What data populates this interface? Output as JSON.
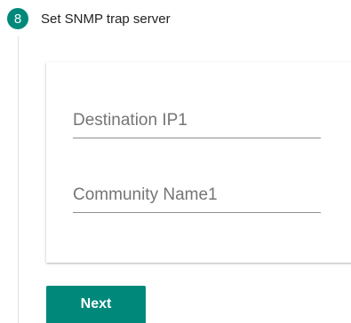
{
  "step": {
    "number": "8",
    "title": "Set SNMP trap server"
  },
  "form": {
    "destination_ip": {
      "placeholder": "Destination IP1",
      "value": ""
    },
    "community_name": {
      "placeholder": "Community Name1",
      "value": ""
    }
  },
  "actions": {
    "next_label": "Next"
  },
  "colors": {
    "accent": "#00897b"
  }
}
